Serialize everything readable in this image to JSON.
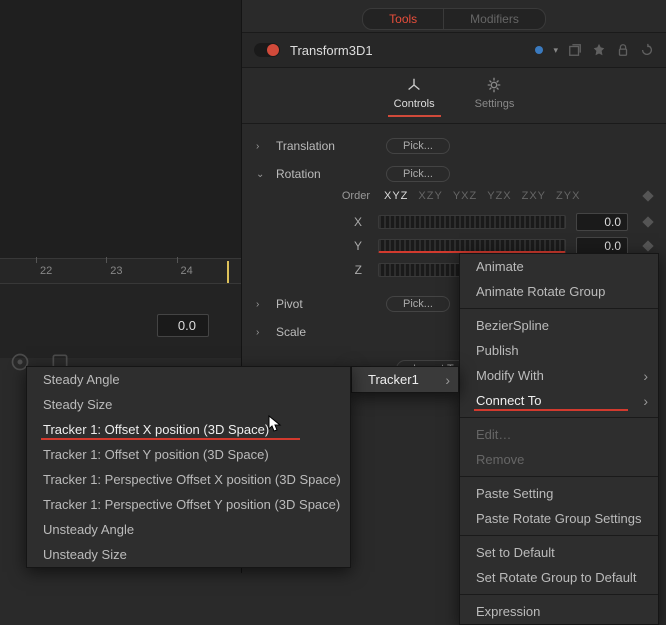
{
  "tabs": {
    "tools": "Tools",
    "modifiers": "Modifiers"
  },
  "node": {
    "title": "Transform3D1"
  },
  "subtabs": {
    "controls": "Controls",
    "settings": "Settings"
  },
  "params": {
    "translation": {
      "label": "Translation",
      "pick": "Pick..."
    },
    "rotation": {
      "label": "Rotation",
      "pick": "Pick..."
    },
    "order": {
      "label": "Order",
      "opts": [
        "XYZ",
        "XZY",
        "YXZ",
        "YZX",
        "ZXY",
        "ZYX"
      ]
    },
    "axes": {
      "x": {
        "label": "X",
        "value": "0.0"
      },
      "y": {
        "label": "Y",
        "value": "0.0"
      },
      "z": {
        "label": "Z"
      }
    },
    "pivot": {
      "label": "Pivot",
      "pick": "Pick..."
    },
    "scale": {
      "label": "Scale"
    },
    "import": "Import Tra"
  },
  "timeline": {
    "t22": "22",
    "t23": "23",
    "t24": "24",
    "value": "0.0"
  },
  "menu1": {
    "animate": "Animate",
    "animate_group": "Animate Rotate Group",
    "bezier": "BezierSpline",
    "publish": "Publish",
    "modify_with": "Modify With",
    "connect_to": "Connect To",
    "edit": "Edit…",
    "remove": "Remove",
    "paste_setting": "Paste Setting",
    "paste_group": "Paste Rotate Group Settings",
    "set_default": "Set to Default",
    "set_group_default": "Set Rotate Group to Default",
    "expression": "Expression"
  },
  "menu2": {
    "tracker": "Tracker1"
  },
  "menu3": {
    "steady_angle": "Steady Angle",
    "steady_size": "Steady Size",
    "t1_ox": "Tracker 1: Offset X position (3D Space)",
    "t1_oy": "Tracker 1: Offset Y position (3D Space)",
    "t1_pox": "Tracker 1: Perspective Offset X position (3D Space)",
    "t1_poy": "Tracker 1: Perspective Offset Y position (3D Space)",
    "unsteady_angle": "Unsteady Angle",
    "unsteady_size": "Unsteady Size"
  }
}
